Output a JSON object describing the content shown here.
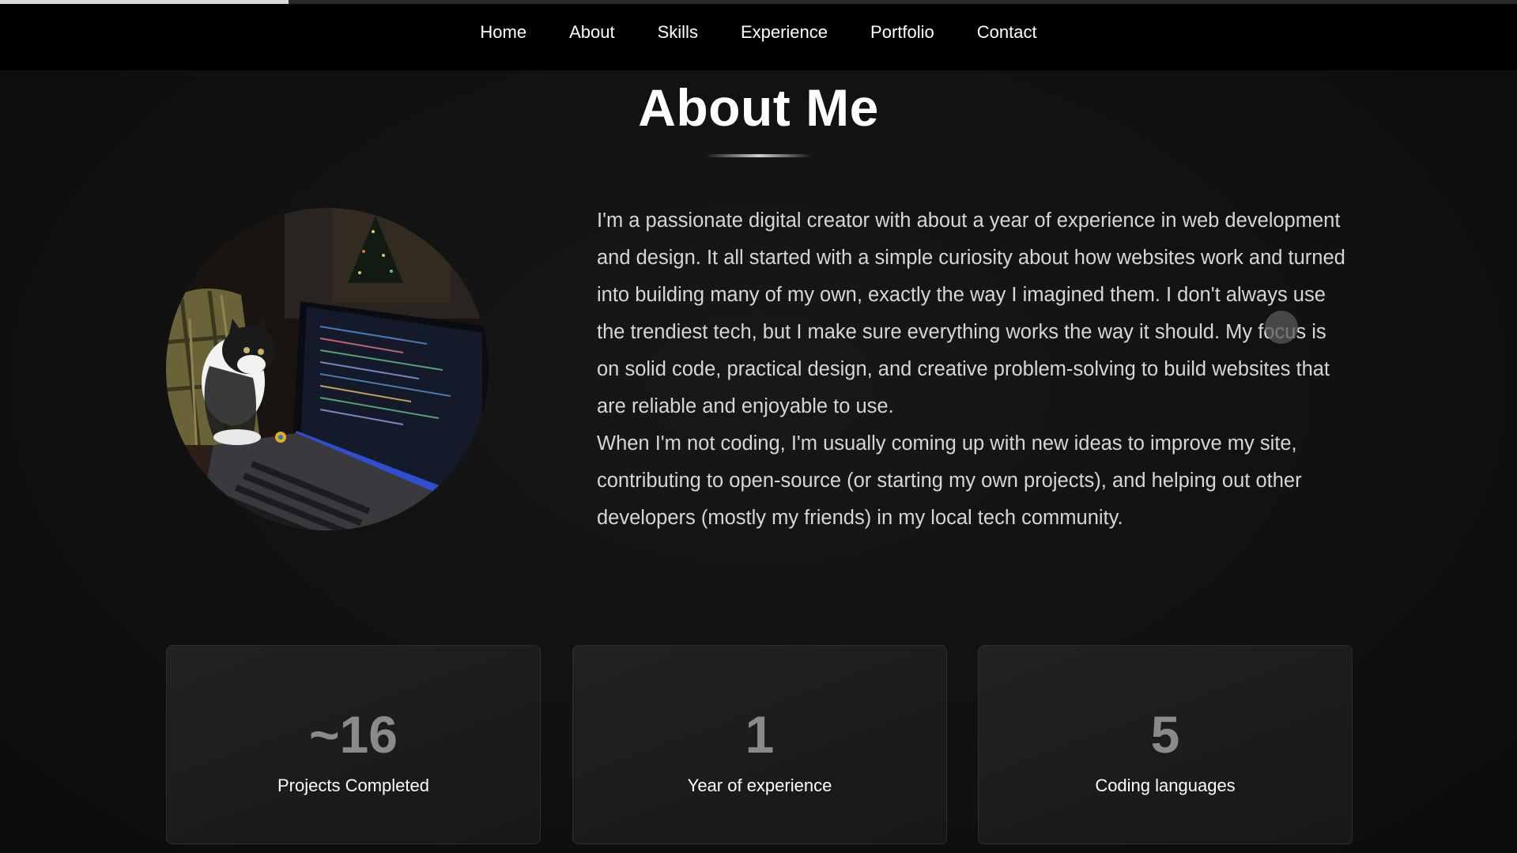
{
  "scroll_progress": 0.19,
  "nav": {
    "items": [
      {
        "label": "Home"
      },
      {
        "label": "About"
      },
      {
        "label": "Skills"
      },
      {
        "label": "Experience"
      },
      {
        "label": "Portfolio"
      },
      {
        "label": "Contact"
      }
    ]
  },
  "about": {
    "title": "About Me",
    "paragraph1": "I'm a passionate digital creator with about a year of experience in web development and design. It all started with a simple curiosity about how websites work and turned into building many of my own, exactly the way I imagined them. I don't always use the trendiest tech, but I make sure everything works the way it should. My focus is on solid code, practical design, and creative problem-solving to build websites that are reliable and enjoyable to use.",
    "paragraph2": "When I'm not coding, I'm usually coming up with new ideas to improve my site, contributing to open-source (or starting my own projects), and helping out other developers (mostly my friends) in my local tech community."
  },
  "stats": [
    {
      "value": "~16",
      "label": "Projects Completed"
    },
    {
      "value": "1",
      "label": "Year of experience"
    },
    {
      "value": "5",
      "label": "Coding languages"
    }
  ],
  "colors": {
    "background": "#111111",
    "navbar": "#000000",
    "card": "#1e1e1e",
    "stat_value": "#8a8a8a",
    "body_text": "#d6d6d6"
  }
}
